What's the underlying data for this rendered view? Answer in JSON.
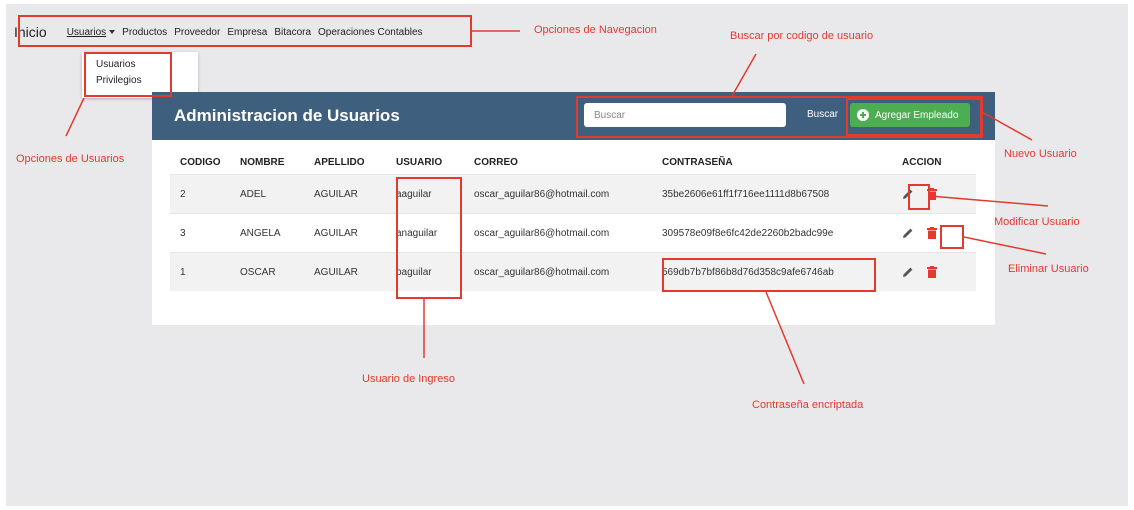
{
  "nav": {
    "brand": "Inicio",
    "items": [
      "Usuarios",
      "Productos",
      "Proveedor",
      "Empresa",
      "Bitacora",
      "Operaciones Contables"
    ]
  },
  "dropdown": {
    "items": [
      "Usuarios",
      "Privilegios"
    ]
  },
  "panel": {
    "title": "Administracion de Usuarios",
    "search_placeholder": "Buscar",
    "search_label": "Buscar",
    "add_label": "Agregar Empleado"
  },
  "table": {
    "headers": [
      "CODIGO",
      "NOMBRE",
      "APELLIDO",
      "USUARIO",
      "CORREO",
      "CONTRASEÑA",
      "ACCION"
    ],
    "rows": [
      [
        "2",
        "ADEL",
        "AGUILAR",
        "aaguilar",
        "oscar_aguilar86@hotmail.com",
        "35be2606e61ff1f716ee1111d8b67508"
      ],
      [
        "3",
        "ANGELA",
        "AGUILAR",
        "anaguilar",
        "oscar_aguilar86@hotmail.com",
        "309578e09f8e6fc42de2260b2badc99e"
      ],
      [
        "1",
        "OSCAR",
        "AGUILAR",
        "oaguilar",
        "oscar_aguilar86@hotmail.com",
        "569db7b7bf86b8d76d358c9afe6746ab"
      ]
    ]
  },
  "annotations": {
    "nav": "Opciones de Navegacion",
    "search": "Buscar por codigo de usuario",
    "user_options": "Opciones de Usuarios",
    "new_user": "Nuevo Usuario",
    "edit_user": "Modificar Usuario",
    "delete_user": "Eliminar Usuario",
    "login_user": "Usuario de Ingreso",
    "encrypted_password": "Contraseña encriptada"
  },
  "colors": {
    "header": "#3f5f7e",
    "add_button": "#4cae50",
    "delete_icon": "#e23a2e",
    "annotation": "#e23a2e"
  }
}
